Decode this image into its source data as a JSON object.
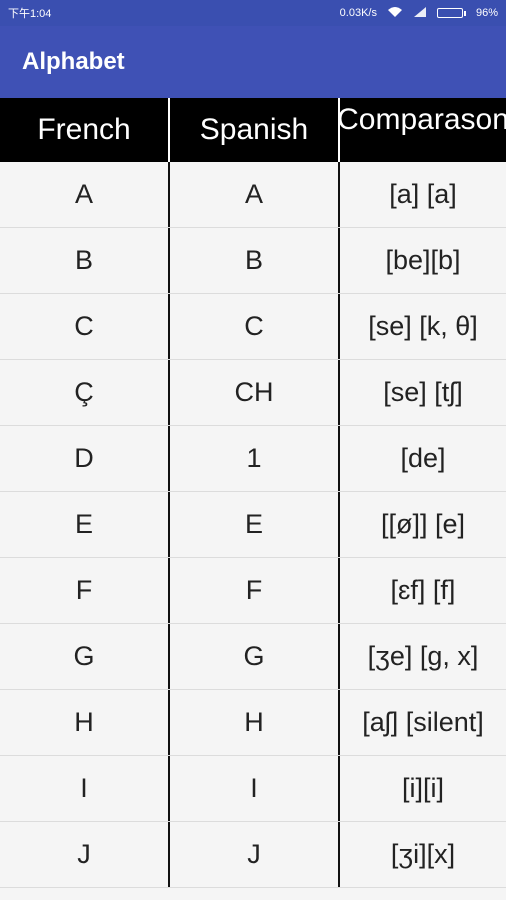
{
  "status_bar": {
    "time": "下午1:04",
    "speed": "0.03K/s",
    "wifi_icon": "wifi-icon",
    "signal_icon": "signal-icon",
    "battery_pct": "96%",
    "battery_level": 0.96
  },
  "app_bar": {
    "title": "Alphabet"
  },
  "table": {
    "headers": [
      "French",
      "Spanish",
      "Comparason"
    ],
    "rows": [
      {
        "french": "A",
        "spanish": "A",
        "comparison": "[a]  [a]"
      },
      {
        "french": "B",
        "spanish": "B",
        "comparison": "[be][b]"
      },
      {
        "french": "C",
        "spanish": "C",
        "comparison": "[se] [k, θ]"
      },
      {
        "french": "Ç",
        "spanish": "CH",
        "comparison": "[se] [tʃ]"
      },
      {
        "french": "D",
        "spanish": "1",
        "comparison": "[de]"
      },
      {
        "french": "E",
        "spanish": "E",
        "comparison": "[[ø]] [e]"
      },
      {
        "french": "F",
        "spanish": "F",
        "comparison": "[ɛf] [f]"
      },
      {
        "french": "G",
        "spanish": "G",
        "comparison": "[ʒe] [g, x]"
      },
      {
        "french": "H",
        "spanish": "H",
        "comparison": "[aʃ] [silent]"
      },
      {
        "french": "I",
        "spanish": "I",
        "comparison": "[i][i]"
      },
      {
        "french": "J",
        "spanish": "J",
        "comparison": "[ʒi][x]"
      }
    ]
  },
  "colors": {
    "status_bar": "#3a4fb0",
    "app_bar": "#3f51b5",
    "header_bg": "#000000"
  }
}
